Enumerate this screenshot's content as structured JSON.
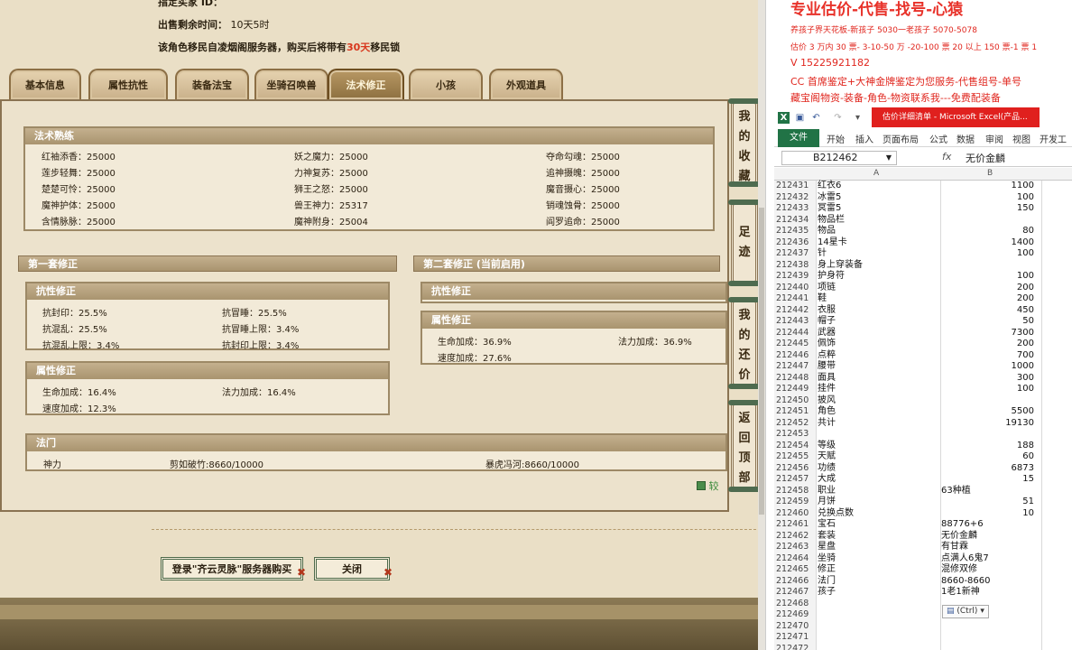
{
  "game": {
    "top_line_1": "指定买家 ID：",
    "sale_time_label": "出售剩余时间：",
    "sale_time_value": "10天5时",
    "migrate_text_a": "该角色移民自凌烟阁服务器，购买后将带有",
    "migrate_days": "30天",
    "migrate_text_b": "移民锁",
    "tabs": [
      "基本信息",
      "属性抗性",
      "装备法宝",
      "坐骑召唤兽",
      "法术修正",
      "小孩",
      "外观道具"
    ],
    "active_tab": "法术修正",
    "skills_header": "法术熟练",
    "skills": [
      [
        "红袖添香：25000",
        "妖之魔力：25000",
        "夺命勾魂：25000"
      ],
      [
        "莲步轻舞：25000",
        "力神复苏：25000",
        "追神摄魄：25000"
      ],
      [
        "楚楚可怜：25000",
        "狮王之怒：25000",
        "魔音摄心：25000"
      ],
      [
        "魔神护体：25000",
        "兽王神力：25317",
        "销魂蚀骨：25000"
      ],
      [
        "含情脉脉：25000",
        "魔神附身：25004",
        "阎罗追命：25000"
      ]
    ],
    "set1_header": "第一套修正",
    "set2_header": "第二套修正 (当前启用)",
    "resist_header": "抗性修正",
    "attr_header": "属性修正",
    "set1_resist": [
      "抗封印：25.5%",
      "抗冒睡：25.5%",
      "抗混乱：25.5%",
      "抗冒睡上限：3.4%",
      "抗混乱上限：3.4%",
      "抗封印上限：3.4%"
    ],
    "set1_attr": [
      "生命加成：16.4%",
      "法力加成：16.4%",
      "速度加成：12.3%"
    ],
    "set2_attr": [
      "生命加成：36.9%",
      "法力加成：36.9%",
      "速度加成：27.6%"
    ],
    "fa_men_header": "法门",
    "fa_men": [
      "神力",
      "剪如破竹:8660/10000",
      "暴虎冯河:8660/10000"
    ],
    "side_buttons": [
      "我的收藏",
      "足迹",
      "我的还价",
      "返回顶部"
    ],
    "compare_label": "较",
    "buy_button": "登录\"齐云灵脉\"服务器购买",
    "close_button": "关闭"
  },
  "excel": {
    "promo_title": "专业估价-代售-找号-心猿",
    "promo_lines": [
      "养孩子界天花板-新孩子 5030一老孩子 5070-5078",
      "估价 3 万内 30 票- 3-10-50 万 -20-100 票 20 以上 150 票-1 票 1",
      "V 15225921182",
      "CC 首席鉴定+大神金牌鉴定为您服务-代售组号-单号",
      "藏宝阁物资-装备-角色-物资联系我---免费配装备"
    ],
    "window_title": "估价详细清单 - Microsoft Excel(产品...",
    "file_tab": "文件",
    "ribbon_tabs": [
      "开始",
      "插入",
      "页面布局",
      "公式",
      "数据",
      "审阅",
      "视图",
      "开发工"
    ],
    "name_box": "B212462",
    "fx_symbol": "fx",
    "formula_value": "无价金麟",
    "col_headers": [
      "A",
      "B"
    ],
    "rows": [
      [
        "212431",
        "红衣6",
        "1100"
      ],
      [
        "212432",
        "冰雷5",
        "100"
      ],
      [
        "212433",
        "冥雷5",
        "150"
      ],
      [
        "212434",
        "物品栏",
        ""
      ],
      [
        "212435",
        "物品",
        "80"
      ],
      [
        "212436",
        "14星卡",
        "1400"
      ],
      [
        "212437",
        "针",
        "100"
      ],
      [
        "212438",
        "身上穿装备",
        ""
      ],
      [
        "212439",
        "护身符",
        "100"
      ],
      [
        "212440",
        "项链",
        "200"
      ],
      [
        "212441",
        "鞋",
        "200"
      ],
      [
        "212442",
        "衣服",
        "450"
      ],
      [
        "212443",
        "帽子",
        "50"
      ],
      [
        "212444",
        "武器",
        "7300"
      ],
      [
        "212445",
        "佩饰",
        "200"
      ],
      [
        "212446",
        "点粹",
        "700"
      ],
      [
        "212447",
        "腰带",
        "1000"
      ],
      [
        "212448",
        "面具",
        "300"
      ],
      [
        "212449",
        "挂件",
        "100"
      ],
      [
        "212450",
        "披风",
        ""
      ],
      [
        "212451",
        "角色",
        "5500"
      ],
      [
        "212452",
        "共计",
        "19130"
      ],
      [
        "212453",
        "",
        ""
      ],
      [
        "212454",
        "等级",
        "188"
      ],
      [
        "212455",
        "天赋",
        "60"
      ],
      [
        "212456",
        "功绩",
        "6873"
      ],
      [
        "212457",
        "大成",
        "15"
      ],
      [
        "212458",
        "职业",
        "63种植"
      ],
      [
        "212459",
        "月饼",
        "51"
      ],
      [
        "212460",
        "兑换点数",
        "10"
      ],
      [
        "212461",
        "宝石",
        "88776+6"
      ],
      [
        "212462",
        "套装",
        "无价金麟"
      ],
      [
        "212463",
        "星盘",
        "有甘霖"
      ],
      [
        "212464",
        "坐骑",
        "点满人6鬼7"
      ],
      [
        "212465",
        "修正",
        "混修双修"
      ],
      [
        "212466",
        "法门",
        "8660-8660"
      ],
      [
        "212467",
        "孩子",
        "1老1新神"
      ],
      [
        "212468",
        "",
        ""
      ],
      [
        "212469",
        "",
        ""
      ],
      [
        "212470",
        "",
        ""
      ],
      [
        "212471",
        "",
        ""
      ],
      [
        "212472",
        "",
        ""
      ]
    ],
    "paste_hint": "(Ctrl)"
  },
  "colors": {
    "accent_red": "#e0261e",
    "excel_green": "#217346",
    "panel_brown": "#a9946f"
  }
}
